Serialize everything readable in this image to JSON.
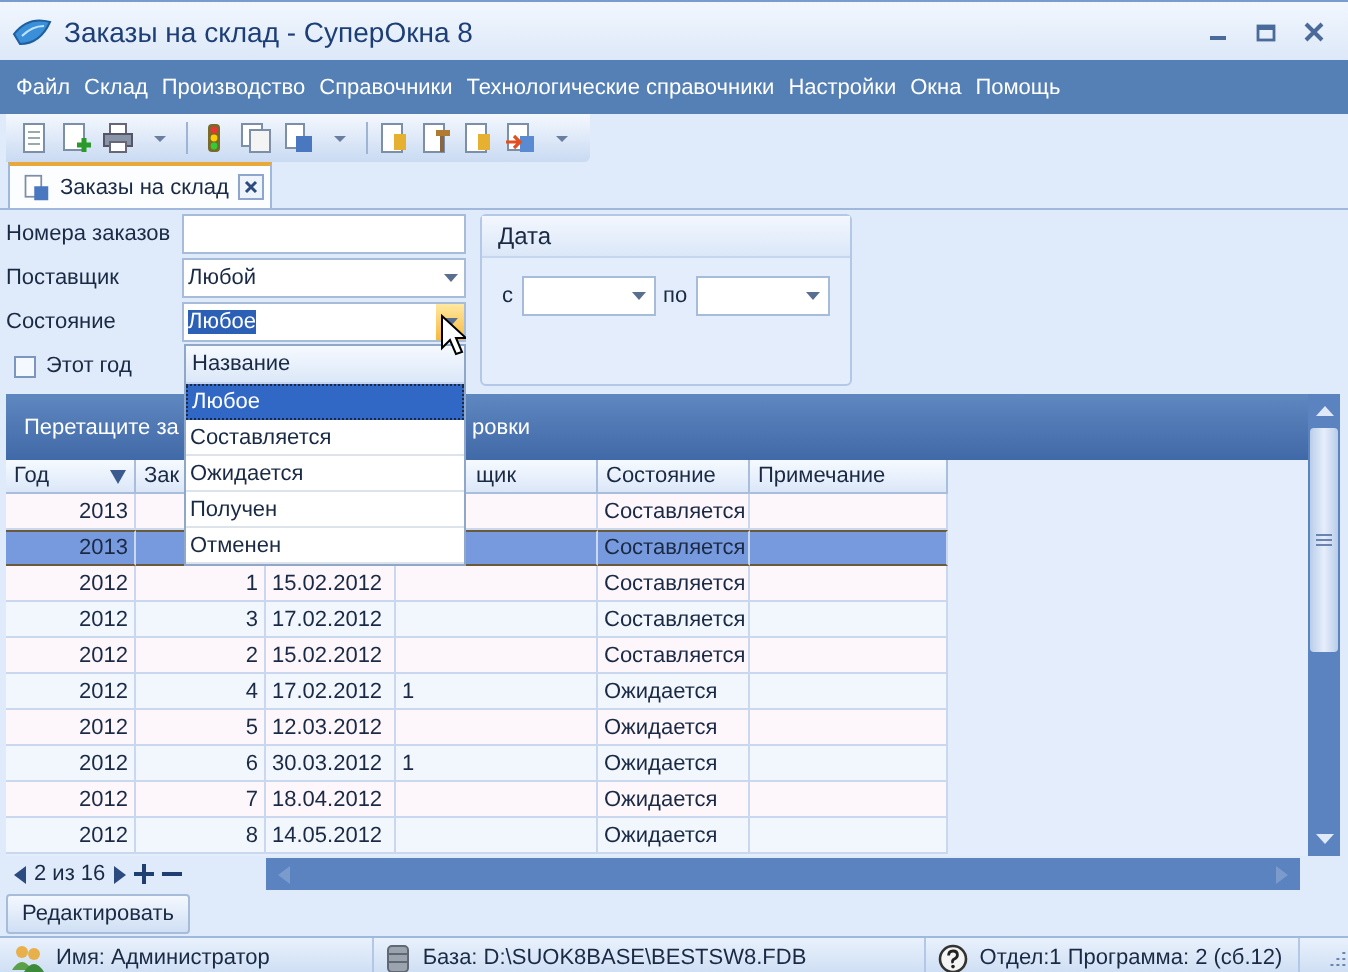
{
  "window": {
    "title": "Заказы на склад - СуперОкна 8"
  },
  "menu": [
    "Файл",
    "Склад",
    "Производство",
    "Справочники",
    "Технологические справочники",
    "Настройки",
    "Окна",
    "Помощь"
  ],
  "tabs": [
    {
      "label": "Заказы на склад",
      "selected": true
    }
  ],
  "filters": {
    "order_numbers": {
      "label": "Номера заказов"
    },
    "supplier": {
      "label": "Поставщик",
      "value": "Любой"
    },
    "state": {
      "label": "Состояние",
      "value": "Любое",
      "expanded": true
    },
    "this_year": {
      "label": "Этот год",
      "checked": false
    },
    "date": {
      "title": "Дата",
      "from_label": "с",
      "to_label": "по"
    }
  },
  "dropdown": {
    "column": "Название",
    "items": [
      {
        "label": "Любое",
        "selected": true
      },
      {
        "label": "Составляется",
        "selected": false
      },
      {
        "label": "Ожидается",
        "selected": false
      },
      {
        "label": "Получен",
        "selected": false
      },
      {
        "label": "Отменен",
        "selected": false
      }
    ]
  },
  "grid": {
    "group_panel": [
      "Перетащите за",
      "ровки"
    ],
    "columns": [
      {
        "label": "Год",
        "sorted": true
      },
      {
        "label": "Зак"
      },
      {},
      {
        "label": "щик"
      },
      {
        "label": "Состояние"
      },
      {
        "label": "Примечание"
      }
    ],
    "rows": [
      {
        "year": "2013",
        "state": "Составляется",
        "selected": false
      },
      {
        "year": "2013",
        "state": "Составляется",
        "selected": true
      },
      {
        "year": "2012",
        "number": "1",
        "date": "15.02.2012",
        "state": "Составляется",
        "selected": false
      },
      {
        "year": "2012",
        "number": "3",
        "date": "17.02.2012",
        "state": "Составляется",
        "selected": false
      },
      {
        "year": "2012",
        "number": "2",
        "date": "15.02.2012",
        "state": "Составляется",
        "selected": false
      },
      {
        "year": "2012",
        "number": "4",
        "date": "17.02.2012",
        "supplier": "1",
        "state": "Ожидается",
        "selected": false
      },
      {
        "year": "2012",
        "number": "5",
        "date": "12.03.2012",
        "state": "Ожидается",
        "selected": false
      },
      {
        "year": "2012",
        "number": "6",
        "date": "30.03.2012",
        "supplier": "1",
        "state": "Ожидается",
        "selected": false
      },
      {
        "year": "2012",
        "number": "7",
        "date": "18.04.2012",
        "state": "Ожидается",
        "selected": false
      },
      {
        "year": "2012",
        "number": "8",
        "date": "14.05.2012",
        "state": "Ожидается",
        "selected": false
      }
    ],
    "navigator": {
      "position": "2 из 16"
    }
  },
  "edit_button": "Редактировать",
  "status_bar": [
    {
      "kind": "user",
      "text": "Имя: Администратор"
    },
    {
      "kind": "database",
      "text": "База: D:\\SUOK8BASE\\BESTSW8.FDB"
    },
    {
      "kind": "help",
      "text": "Отдел:1 Программа: 2 (сб.12)"
    }
  ]
}
